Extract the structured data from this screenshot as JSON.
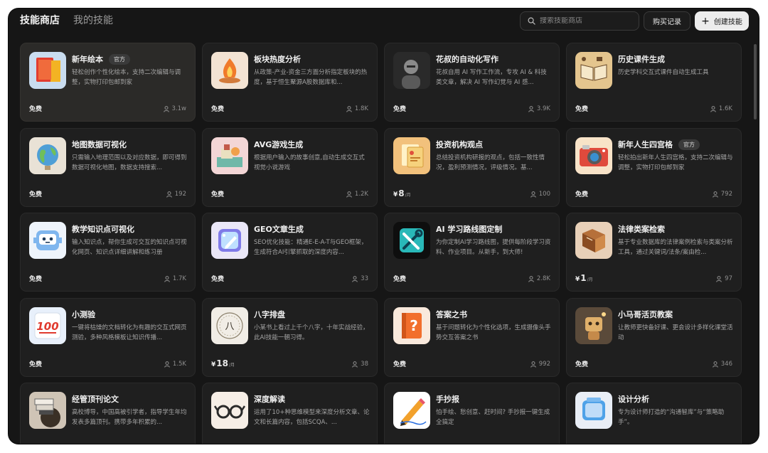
{
  "header": {
    "tab_store": "技能商店",
    "tab_mine": "我的技能",
    "search_placeholder": "搜索技能商店",
    "purchase_history": "购买记录",
    "create_skill": "创建技能"
  },
  "cards": [
    {
      "title": "新年绘本",
      "badge": "官方",
      "desc": "轻松创作个性化绘本，支持二次编辑与调整，实物打印包邮到家",
      "price": "免费",
      "users": "3.1w",
      "icon": "book-icon"
    },
    {
      "title": "板块热度分析",
      "badge": "",
      "desc": "从政策-产业-资金三方面分析指定板块的热度，基于恒生聚源A股数据库和...",
      "price": "免费",
      "users": "1.8K",
      "icon": "flame-icon"
    },
    {
      "title": "花叔的自动化写作",
      "badge": "",
      "desc": "花叔自用 AI 写作工作流，专攻 AI & 科技类文章，解决 AI 写作幻觉与 AI 感...",
      "price": "免费",
      "users": "3.9K",
      "icon": "portrait-icon"
    },
    {
      "title": "历史课件生成",
      "badge": "",
      "desc": "历史学科交互式课件自动生成工具",
      "price": "免费",
      "users": "1.6K",
      "icon": "open-book-icon"
    },
    {
      "title": "地图数据可视化",
      "badge": "",
      "desc": "只需输入地理范围以及对应数据，即可得到数据可视化地图，数据支持搜索...",
      "price": "免费",
      "users": "192",
      "icon": "globe-icon"
    },
    {
      "title": "AVG游戏生成",
      "badge": "",
      "desc": "根据用户输入的故事创意,自动生成交互式视觉小说游戏",
      "price": "免费",
      "users": "1.2K",
      "icon": "diorama-icon"
    },
    {
      "title": "投资机构观点",
      "badge": "",
      "desc": "总结投资机构研报的观点，包括一致性情况，盈利预测情况，评级情况。基...",
      "price": "",
      "price_amount": "8",
      "price_unit": "/月",
      "price_symbol": "¥",
      "users": "100",
      "icon": "notes-icon"
    },
    {
      "title": "新年人生四宫格",
      "badge": "官方",
      "desc": "轻松拍出新年人生四宫格，支持二次编辑与调整，实物打印包邮到家",
      "price": "免费",
      "users": "792",
      "icon": "camera-icon"
    },
    {
      "title": "教学知识点可视化",
      "badge": "",
      "desc": "输入知识点，帮你生成可交互的知识点可视化网页、知识点详细讲解和练习册",
      "price": "免费",
      "users": "1.7K",
      "icon": "robot-icon"
    },
    {
      "title": "GEO文章生成",
      "badge": "",
      "desc": "SEO优化技能：精通E-E-A-T与GEO框架，生成符合AI引擎抓取的深度内容...",
      "price": "免费",
      "users": "33",
      "icon": "edit-card-icon"
    },
    {
      "title": "AI 学习路线图定制",
      "badge": "",
      "desc": "为你定制AI学习路线图，提供每阶段学习资料、作业项目。从新手，到大师!",
      "price": "免费",
      "users": "2.8K",
      "icon": "tools-icon"
    },
    {
      "title": "法律类案检索",
      "badge": "",
      "desc": "基于专业数据库的法律案例检索与类案分析工具，通过关键词/法条/案由检...",
      "price": "",
      "price_amount": "1",
      "price_unit": "/月",
      "price_symbol": "¥",
      "users": "97",
      "icon": "law-book-icon"
    },
    {
      "title": "小测验",
      "badge": "",
      "desc": "一键将枯燥的文档转化为有趣的交互式网页测验，多种风格模板让知识传播...",
      "price": "免费",
      "users": "1.5K",
      "icon": "score-100-icon"
    },
    {
      "title": "八字排盘",
      "badge": "",
      "desc": "小某书上看过上千个八字，十年实战经验，此AI技能一朝习得。",
      "price": "",
      "price_amount": "18",
      "price_unit": "/月",
      "price_symbol": "¥",
      "users": "38",
      "icon": "bazi-seal-icon"
    },
    {
      "title": "答案之书",
      "badge": "",
      "desc": "基于问题转化为个性化选项，生成摄像头手势交互答案之书",
      "price": "免费",
      "users": "992",
      "icon": "question-book-icon"
    },
    {
      "title": "小马哥活页教案",
      "badge": "",
      "desc": "让教师更快备好课、更会设计多样化课堂活动",
      "price": "免费",
      "users": "346",
      "icon": "lesson-robot-icon"
    },
    {
      "title": "经管顶刊论文",
      "badge": "",
      "desc": "高校博导，中国高被引学者，指导学生年均发表多篇顶刊。携带多年积累的...",
      "price": "",
      "users": "",
      "icon": "globe-books-icon"
    },
    {
      "title": "深度解读",
      "badge": "",
      "desc": "运用了10+种思维模型来深度分析文章、论文和长篇内容，包括SCQA、...",
      "price": "",
      "users": "",
      "icon": "glasses-icon"
    },
    {
      "title": "手抄报",
      "badge": "",
      "desc": "怕手绘、愁创意、赶时间? 手抄报一键生成全搞定",
      "price": "",
      "users": "",
      "icon": "pencil-icon"
    },
    {
      "title": "设计分析",
      "badge": "",
      "desc": "专为设计师打造的“沟通智库”与“策略助手”。",
      "price": "",
      "users": "",
      "icon": "design-tile-icon"
    }
  ]
}
